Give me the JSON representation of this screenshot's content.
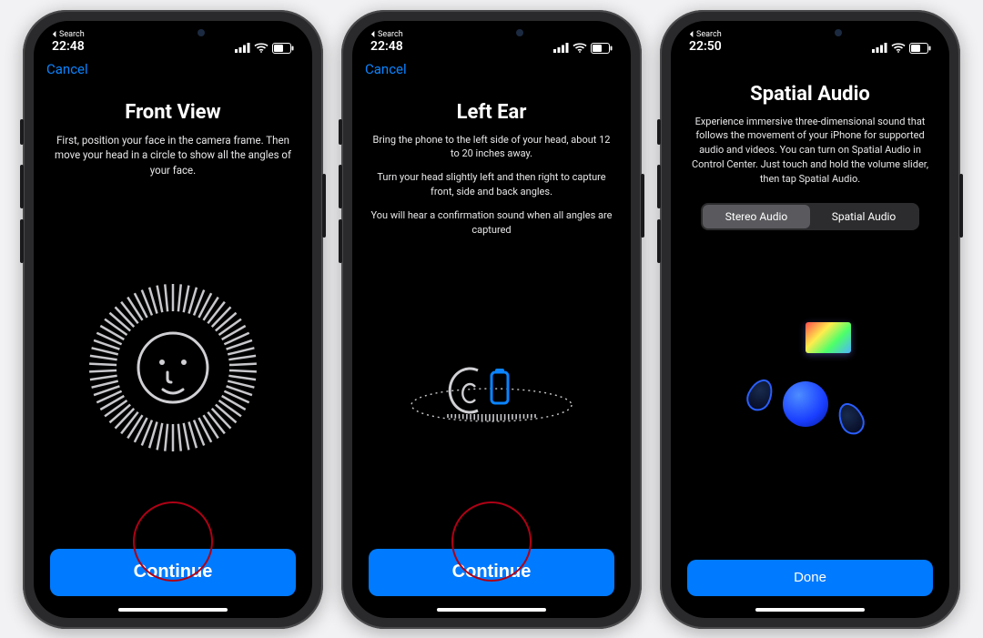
{
  "status": {
    "time_a": "22:48",
    "time_b": "22:48",
    "time_c": "22:50",
    "back_label": "Search"
  },
  "nav": {
    "cancel": "Cancel"
  },
  "screen1": {
    "title": "Front View",
    "desc": "First, position your face in the camera frame. Then move your head in a circle to show all the angles of your face.",
    "cta": "Continue"
  },
  "screen2": {
    "title": "Left Ear",
    "desc1": "Bring the phone to the left side of your head, about 12 to 20 inches away.",
    "desc2": "Turn your head slightly left and then right to capture front, side and back angles.",
    "desc3": "You will hear a confirmation sound when all angles are captured",
    "cta": "Continue"
  },
  "screen3": {
    "title": "Spatial Audio",
    "desc": "Experience immersive three-dimensional sound that follows the movement of your iPhone for supported audio and videos. You can turn on Spatial Audio in Control Center. Just touch and hold the volume slider, then tap Spatial Audio.",
    "seg_a": "Stereo Audio",
    "seg_b": "Spatial Audio",
    "cta": "Done"
  }
}
